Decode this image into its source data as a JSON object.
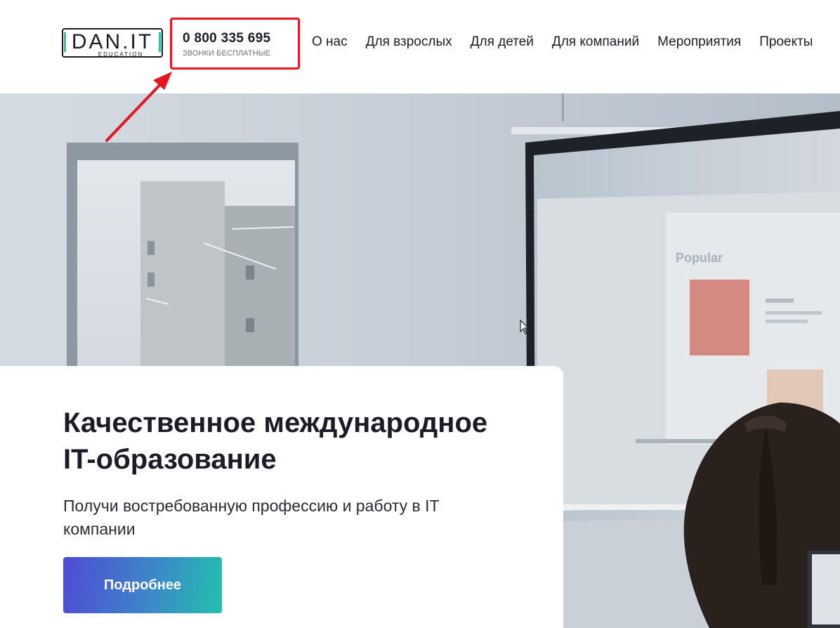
{
  "header": {
    "logo": {
      "text": "DAN.IT",
      "subtext": "EDUCATION"
    },
    "phone": {
      "number": "0 800 335 695",
      "caption": "ЗВОНКИ БЕСПЛАТНЫЕ"
    },
    "nav": [
      {
        "label": "О нас"
      },
      {
        "label": "Для взрослых"
      },
      {
        "label": "Для детей"
      },
      {
        "label": "Для компаний"
      },
      {
        "label": "Мероприятия"
      },
      {
        "label": "Проекты"
      }
    ]
  },
  "hero": {
    "title_line1": "Качественное международное",
    "title_line2": "IT-образование",
    "subtitle": "Получи востребованную профессию и работу в IT компании",
    "cta_label": "Подробнее",
    "screen_heading": "Popular"
  },
  "colors": {
    "annotation": "#e8141e",
    "cta_start": "#4f4bd4",
    "cta_end": "#22c1ae",
    "text_dark": "#1c1c28"
  }
}
